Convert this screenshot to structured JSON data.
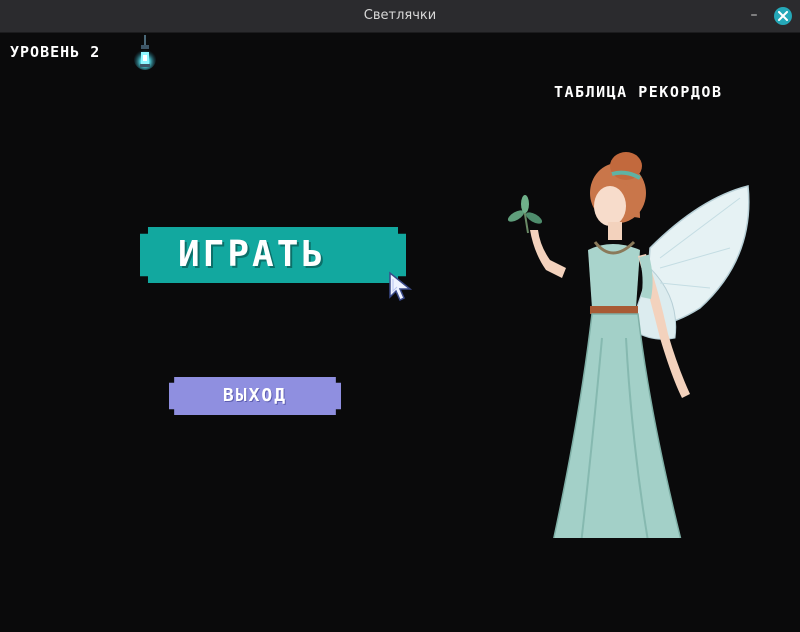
{
  "window": {
    "title": "Светлячки"
  },
  "hud": {
    "level": "УРОВЕНЬ 2",
    "records_link": "ТАБЛИЦА РЕКОРДОВ"
  },
  "menu": {
    "play_label": "ИГРАТЬ",
    "exit_label": "ВЫХОД"
  },
  "colors": {
    "play": "#12a89f",
    "exit": "#8f8fe0",
    "background": "#0a0a0b",
    "lantern_glow": "#5ff3ff"
  },
  "icons": {
    "lantern": "lantern-icon",
    "cursor": "mouse-cursor-icon",
    "close": "close-icon",
    "minimize": "minimize-icon"
  }
}
